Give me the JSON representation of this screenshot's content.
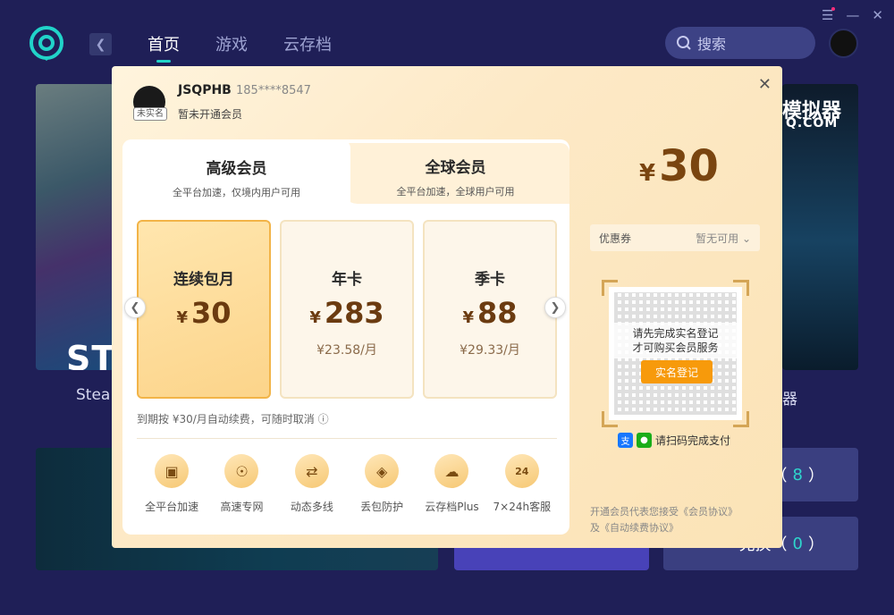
{
  "app": {
    "nav": [
      {
        "label": "首页",
        "active": true
      },
      {
        "label": "游戏",
        "active": false
      },
      {
        "label": "云存档",
        "active": false
      }
    ],
    "search_placeholder": "搜索",
    "cards": {
      "steam_overlay": "ST",
      "steam_label": "Stea",
      "emu_title": "模拟器",
      "emu_sub": "Q.COM",
      "emu_label": "器",
      "tile1_label": "戋（",
      "tile1_count": "8",
      "tile1_close": "）",
      "tile2_label": "兑换（",
      "tile2_count": "0",
      "tile2_close": "）"
    }
  },
  "modal": {
    "user": {
      "badge": "未实名",
      "username": "JSQPHB",
      "phone": "185****8547",
      "status": "暂未开通会员"
    },
    "tabs": [
      {
        "title": "高级会员",
        "sub": "全平台加速，仅境内用户可用",
        "active": true
      },
      {
        "title": "全球会员",
        "sub": "全平台加速，全球用户可用",
        "active": false
      }
    ],
    "plans": [
      {
        "name": "连续包月",
        "currency": "¥",
        "price": "30",
        "monthly": "",
        "selected": true
      },
      {
        "name": "年卡",
        "currency": "¥",
        "price": "283",
        "monthly": "¥23.58/月",
        "selected": false
      },
      {
        "name": "季卡",
        "currency": "¥",
        "price": "88",
        "monthly": "¥29.33/月",
        "selected": false
      }
    ],
    "renew_note": "到期按 ¥30/月自动续费，可随时取消 ⓘ",
    "features": [
      {
        "label": "全平台加速",
        "icon": "devices-icon"
      },
      {
        "label": "高速专网",
        "icon": "network-icon"
      },
      {
        "label": "动态多线",
        "icon": "multiline-icon"
      },
      {
        "label": "丢包防护",
        "icon": "shield-icon"
      },
      {
        "label": "云存档Plus",
        "icon": "cloud-upload-icon"
      },
      {
        "label": "7×24h客服",
        "icon": "support-24h-icon"
      }
    ],
    "total": {
      "currency": "¥",
      "amount": "30"
    },
    "coupon": {
      "label": "优惠券",
      "value": "暂无可用"
    },
    "qr": {
      "message_line1": "请先完成实名登记",
      "message_line2": "才可购买会员服务",
      "button": "实名登记"
    },
    "pay_hint": "请扫码完成支付",
    "agreement": {
      "prefix": "开通会员代表您接受",
      "link1": "《会员协议》",
      "mid": "及",
      "link2": "《自动续费协议》"
    },
    "colors": {
      "accent": "#f79a0b",
      "price": "#7a4510",
      "teal": "#21d3c9"
    }
  }
}
